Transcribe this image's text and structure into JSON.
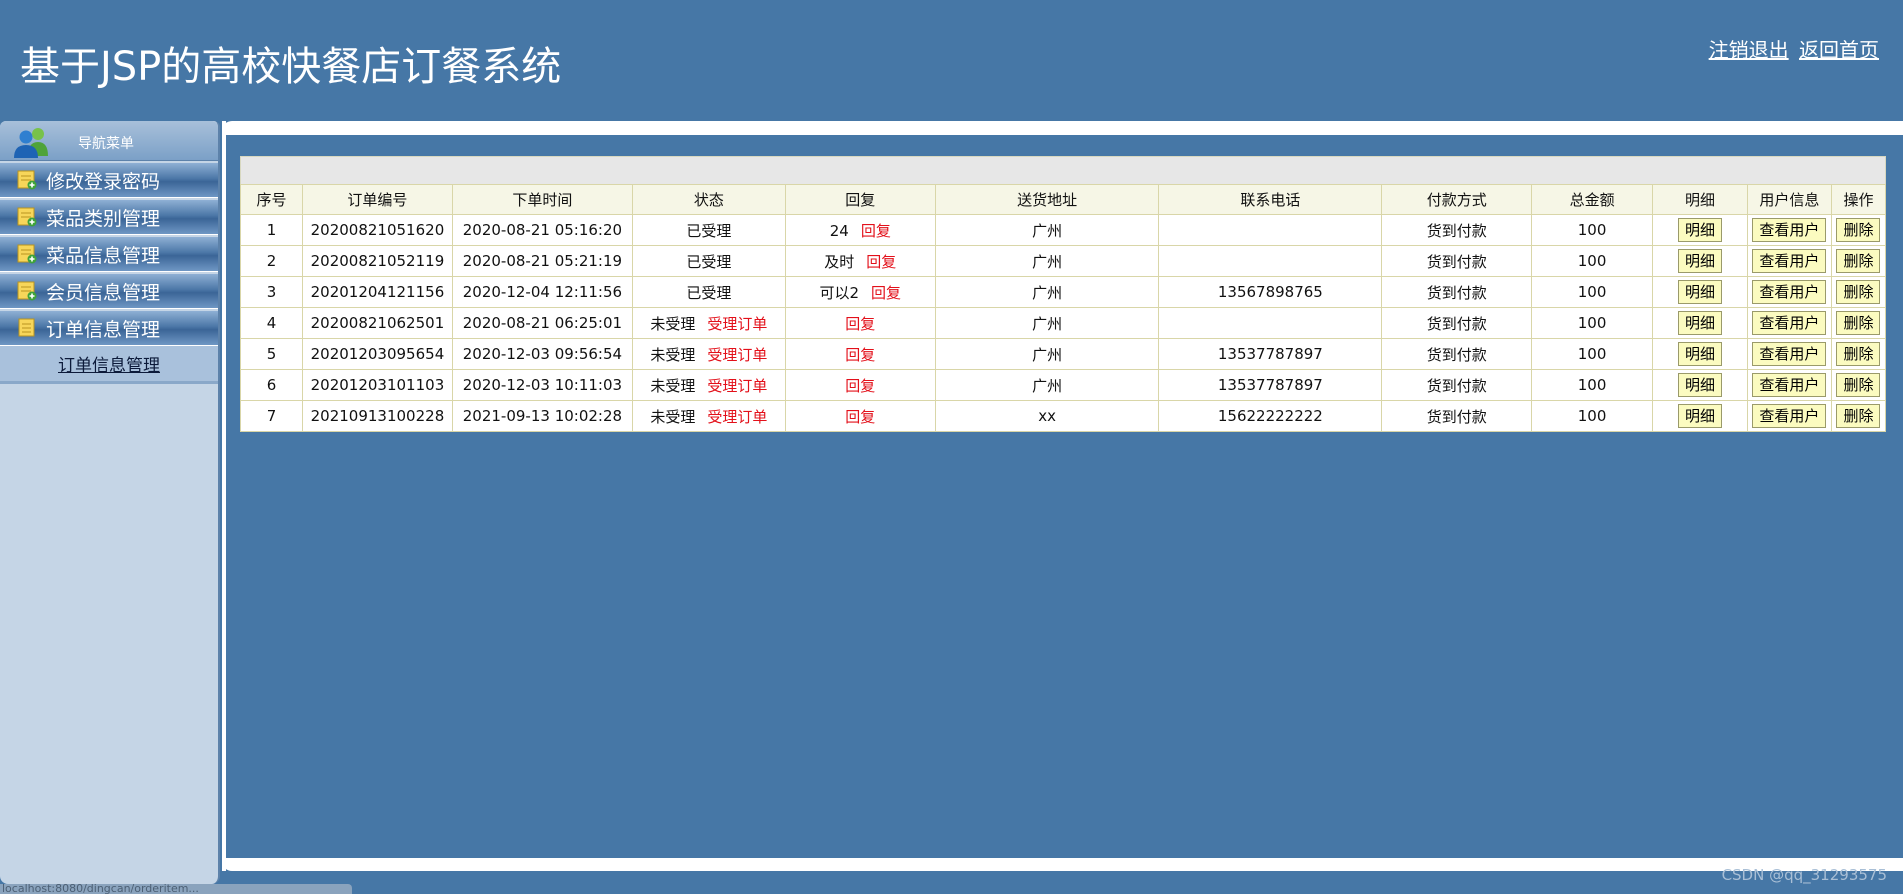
{
  "header": {
    "title": "基于JSP的高校快餐店订餐系统",
    "logout_label": "注销退出",
    "home_label": "返回首页"
  },
  "sidebar": {
    "title": "导航菜单",
    "items": [
      {
        "label": "修改登录密码"
      },
      {
        "label": "菜品类别管理"
      },
      {
        "label": "菜品信息管理"
      },
      {
        "label": "会员信息管理"
      },
      {
        "label": "订单信息管理"
      }
    ],
    "subitem": {
      "label": "订单信息管理"
    }
  },
  "table": {
    "headers": [
      "序号",
      "订单编号",
      "下单时间",
      "状态",
      "回复",
      "送货地址",
      "联系电话",
      "付款方式",
      "总金额",
      "明细",
      "用户信息",
      "操作"
    ],
    "rows": [
      {
        "no": "1",
        "order_id": "20200821051620",
        "time": "2020-08-21 05:16:20",
        "status": "已受理",
        "accept": "",
        "reply_text": "24",
        "reply_link": "回复",
        "address": "广州",
        "phone": "",
        "payment": "货到付款",
        "total": "100",
        "detail": "明细",
        "user": "查看用户",
        "op": "删除"
      },
      {
        "no": "2",
        "order_id": "20200821052119",
        "time": "2020-08-21 05:21:19",
        "status": "已受理",
        "accept": "",
        "reply_text": "及时",
        "reply_link": "回复",
        "address": "广州",
        "phone": "",
        "payment": "货到付款",
        "total": "100",
        "detail": "明细",
        "user": "查看用户",
        "op": "删除"
      },
      {
        "no": "3",
        "order_id": "20201204121156",
        "time": "2020-12-04 12:11:56",
        "status": "已受理",
        "accept": "",
        "reply_text": "可以2",
        "reply_link": "回复",
        "address": "广州",
        "phone": "13567898765",
        "payment": "货到付款",
        "total": "100",
        "detail": "明细",
        "user": "查看用户",
        "op": "删除"
      },
      {
        "no": "4",
        "order_id": "20200821062501",
        "time": "2020-08-21 06:25:01",
        "status": "未受理",
        "accept": "受理订单",
        "reply_text": "",
        "reply_link": "回复",
        "address": "广州",
        "phone": "",
        "payment": "货到付款",
        "total": "100",
        "detail": "明细",
        "user": "查看用户",
        "op": "删除"
      },
      {
        "no": "5",
        "order_id": "20201203095654",
        "time": "2020-12-03 09:56:54",
        "status": "未受理",
        "accept": "受理订单",
        "reply_text": "",
        "reply_link": "回复",
        "address": "广州",
        "phone": "13537787897",
        "payment": "货到付款",
        "total": "100",
        "detail": "明细",
        "user": "查看用户",
        "op": "删除"
      },
      {
        "no": "6",
        "order_id": "20201203101103",
        "time": "2020-12-03 10:11:03",
        "status": "未受理",
        "accept": "受理订单",
        "reply_text": "",
        "reply_link": "回复",
        "address": "广州",
        "phone": "13537787897",
        "payment": "货到付款",
        "total": "100",
        "detail": "明细",
        "user": "查看用户",
        "op": "删除"
      },
      {
        "no": "7",
        "order_id": "20210913100228",
        "time": "2021-09-13 10:02:28",
        "status": "未受理",
        "accept": "受理订单",
        "reply_text": "",
        "reply_link": "回复",
        "address": "xx",
        "phone": "15622222222",
        "payment": "货到付款",
        "total": "100",
        "detail": "明细",
        "user": "查看用户",
        "op": "删除"
      }
    ]
  },
  "footer": {
    "status_url": "localhost:8080/dingcan/orderitem...",
    "watermark": "CSDN @qq_31293575"
  },
  "colors": {
    "background": "#4677a6",
    "link_red": "#e3101a",
    "button_yellow": "#fbfbc0",
    "table_border": "#d9d6a8"
  }
}
